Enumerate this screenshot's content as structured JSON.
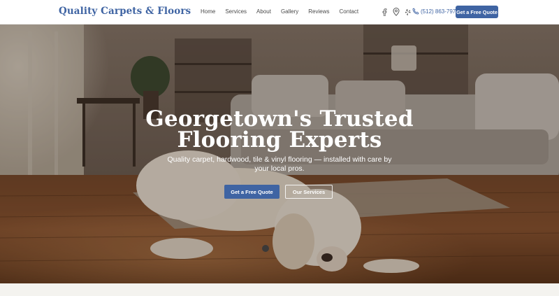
{
  "header": {
    "brand": "Quality Carpets & Floors",
    "nav": [
      "Home",
      "Services",
      "About",
      "Gallery",
      "Reviews",
      "Contact"
    ],
    "social_icons": [
      "facebook-icon",
      "map-pin-icon",
      "yelp-icon"
    ],
    "phone": "(512) 863-7979",
    "cta": "Get a Free Quote"
  },
  "hero": {
    "title_line1": "Georgetown's Trusted",
    "title_line2": "Flooring Experts",
    "subtitle": "Quality carpet, hardwood, tile & vinyl flooring — installed with care by your local pros.",
    "primary_button": "Get a Free Quote",
    "secondary_button": "Our Services"
  },
  "colors": {
    "brand_blue": "#3f64a3",
    "white": "#ffffff"
  }
}
